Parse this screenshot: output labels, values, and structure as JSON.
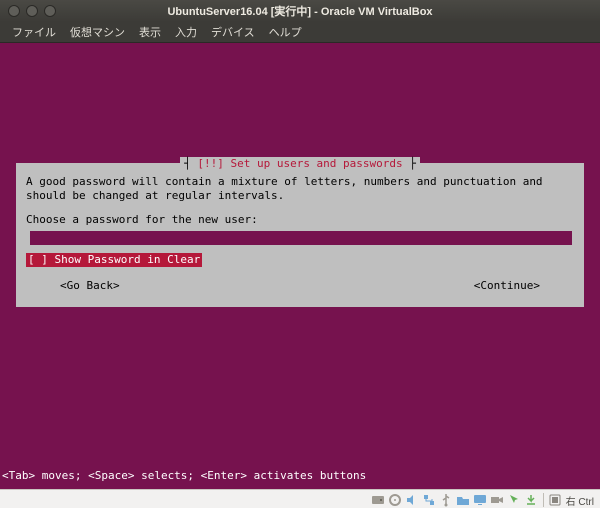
{
  "window": {
    "title": "UbuntuServer16.04 [実行中] - Oracle VM VirtualBox",
    "menus": [
      "ファイル",
      "仮想マシン",
      "表示",
      "入力",
      "デバイス",
      "ヘルプ"
    ]
  },
  "installer": {
    "title_brackets_open": "┤ ",
    "title_marker": "[!!] ",
    "title_text": "Set up users and passwords",
    "title_brackets_close": " ├",
    "help_line": "A good password will contain a mixture of letters, numbers and punctuation and should be changed at regular intervals.",
    "prompt": "Choose a password for the new user:",
    "password_value": "",
    "show_pw_label": "[ ] Show Password in Clear",
    "go_back": "<Go Back>",
    "continue": "<Continue>",
    "tab_hint": "<Tab> moves; <Space> selects; <Enter> activates buttons"
  },
  "statusbar": {
    "host_key": "右 Ctrl",
    "icons": [
      "hdd-icon",
      "cd-icon",
      "sound-icon",
      "network-icon",
      "usb-icon",
      "shared-folder-icon",
      "display-icon",
      "videocap-icon",
      "mouse-icon",
      "keyboard-icon"
    ]
  },
  "colors": {
    "guest_bg": "#76124e",
    "dialog_bg": "#bfbfbf",
    "accent_red": "#b5183a"
  }
}
